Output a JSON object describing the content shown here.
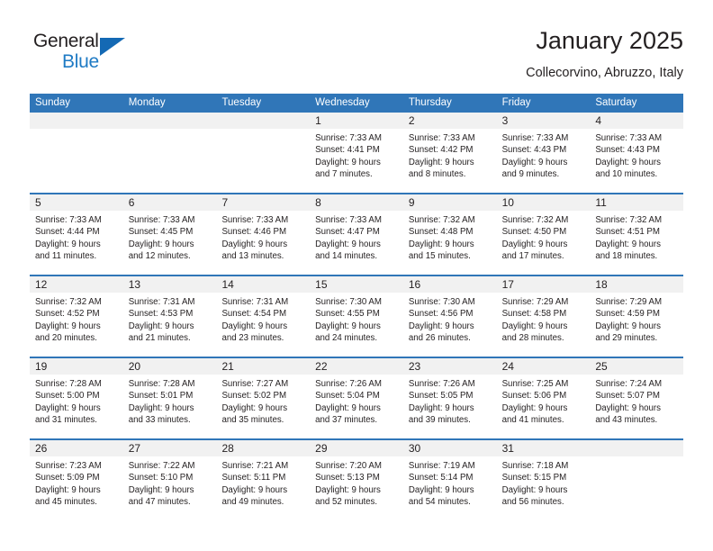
{
  "brand": {
    "name_top": "General",
    "name_bottom": "Blue",
    "accent_color": "#1469b4",
    "blue_text_color": "#1e7ac4"
  },
  "header": {
    "title": "January 2025",
    "subtitle": "Collecorvino, Abruzzo, Italy"
  },
  "calendar": {
    "header_bg": "#3076b8",
    "day_band_bg": "#f1f1f1",
    "weekday_headers": [
      "Sunday",
      "Monday",
      "Tuesday",
      "Wednesday",
      "Thursday",
      "Friday",
      "Saturday"
    ],
    "weeks": [
      [
        {
          "day": "",
          "lines": []
        },
        {
          "day": "",
          "lines": []
        },
        {
          "day": "",
          "lines": []
        },
        {
          "day": "1",
          "lines": [
            "Sunrise: 7:33 AM",
            "Sunset: 4:41 PM",
            "Daylight: 9 hours",
            "and 7 minutes."
          ]
        },
        {
          "day": "2",
          "lines": [
            "Sunrise: 7:33 AM",
            "Sunset: 4:42 PM",
            "Daylight: 9 hours",
            "and 8 minutes."
          ]
        },
        {
          "day": "3",
          "lines": [
            "Sunrise: 7:33 AM",
            "Sunset: 4:43 PM",
            "Daylight: 9 hours",
            "and 9 minutes."
          ]
        },
        {
          "day": "4",
          "lines": [
            "Sunrise: 7:33 AM",
            "Sunset: 4:43 PM",
            "Daylight: 9 hours",
            "and 10 minutes."
          ]
        }
      ],
      [
        {
          "day": "5",
          "lines": [
            "Sunrise: 7:33 AM",
            "Sunset: 4:44 PM",
            "Daylight: 9 hours",
            "and 11 minutes."
          ]
        },
        {
          "day": "6",
          "lines": [
            "Sunrise: 7:33 AM",
            "Sunset: 4:45 PM",
            "Daylight: 9 hours",
            "and 12 minutes."
          ]
        },
        {
          "day": "7",
          "lines": [
            "Sunrise: 7:33 AM",
            "Sunset: 4:46 PM",
            "Daylight: 9 hours",
            "and 13 minutes."
          ]
        },
        {
          "day": "8",
          "lines": [
            "Sunrise: 7:33 AM",
            "Sunset: 4:47 PM",
            "Daylight: 9 hours",
            "and 14 minutes."
          ]
        },
        {
          "day": "9",
          "lines": [
            "Sunrise: 7:32 AM",
            "Sunset: 4:48 PM",
            "Daylight: 9 hours",
            "and 15 minutes."
          ]
        },
        {
          "day": "10",
          "lines": [
            "Sunrise: 7:32 AM",
            "Sunset: 4:50 PM",
            "Daylight: 9 hours",
            "and 17 minutes."
          ]
        },
        {
          "day": "11",
          "lines": [
            "Sunrise: 7:32 AM",
            "Sunset: 4:51 PM",
            "Daylight: 9 hours",
            "and 18 minutes."
          ]
        }
      ],
      [
        {
          "day": "12",
          "lines": [
            "Sunrise: 7:32 AM",
            "Sunset: 4:52 PM",
            "Daylight: 9 hours",
            "and 20 minutes."
          ]
        },
        {
          "day": "13",
          "lines": [
            "Sunrise: 7:31 AM",
            "Sunset: 4:53 PM",
            "Daylight: 9 hours",
            "and 21 minutes."
          ]
        },
        {
          "day": "14",
          "lines": [
            "Sunrise: 7:31 AM",
            "Sunset: 4:54 PM",
            "Daylight: 9 hours",
            "and 23 minutes."
          ]
        },
        {
          "day": "15",
          "lines": [
            "Sunrise: 7:30 AM",
            "Sunset: 4:55 PM",
            "Daylight: 9 hours",
            "and 24 minutes."
          ]
        },
        {
          "day": "16",
          "lines": [
            "Sunrise: 7:30 AM",
            "Sunset: 4:56 PM",
            "Daylight: 9 hours",
            "and 26 minutes."
          ]
        },
        {
          "day": "17",
          "lines": [
            "Sunrise: 7:29 AM",
            "Sunset: 4:58 PM",
            "Daylight: 9 hours",
            "and 28 minutes."
          ]
        },
        {
          "day": "18",
          "lines": [
            "Sunrise: 7:29 AM",
            "Sunset: 4:59 PM",
            "Daylight: 9 hours",
            "and 29 minutes."
          ]
        }
      ],
      [
        {
          "day": "19",
          "lines": [
            "Sunrise: 7:28 AM",
            "Sunset: 5:00 PM",
            "Daylight: 9 hours",
            "and 31 minutes."
          ]
        },
        {
          "day": "20",
          "lines": [
            "Sunrise: 7:28 AM",
            "Sunset: 5:01 PM",
            "Daylight: 9 hours",
            "and 33 minutes."
          ]
        },
        {
          "day": "21",
          "lines": [
            "Sunrise: 7:27 AM",
            "Sunset: 5:02 PM",
            "Daylight: 9 hours",
            "and 35 minutes."
          ]
        },
        {
          "day": "22",
          "lines": [
            "Sunrise: 7:26 AM",
            "Sunset: 5:04 PM",
            "Daylight: 9 hours",
            "and 37 minutes."
          ]
        },
        {
          "day": "23",
          "lines": [
            "Sunrise: 7:26 AM",
            "Sunset: 5:05 PM",
            "Daylight: 9 hours",
            "and 39 minutes."
          ]
        },
        {
          "day": "24",
          "lines": [
            "Sunrise: 7:25 AM",
            "Sunset: 5:06 PM",
            "Daylight: 9 hours",
            "and 41 minutes."
          ]
        },
        {
          "day": "25",
          "lines": [
            "Sunrise: 7:24 AM",
            "Sunset: 5:07 PM",
            "Daylight: 9 hours",
            "and 43 minutes."
          ]
        }
      ],
      [
        {
          "day": "26",
          "lines": [
            "Sunrise: 7:23 AM",
            "Sunset: 5:09 PM",
            "Daylight: 9 hours",
            "and 45 minutes."
          ]
        },
        {
          "day": "27",
          "lines": [
            "Sunrise: 7:22 AM",
            "Sunset: 5:10 PM",
            "Daylight: 9 hours",
            "and 47 minutes."
          ]
        },
        {
          "day": "28",
          "lines": [
            "Sunrise: 7:21 AM",
            "Sunset: 5:11 PM",
            "Daylight: 9 hours",
            "and 49 minutes."
          ]
        },
        {
          "day": "29",
          "lines": [
            "Sunrise: 7:20 AM",
            "Sunset: 5:13 PM",
            "Daylight: 9 hours",
            "and 52 minutes."
          ]
        },
        {
          "day": "30",
          "lines": [
            "Sunrise: 7:19 AM",
            "Sunset: 5:14 PM",
            "Daylight: 9 hours",
            "and 54 minutes."
          ]
        },
        {
          "day": "31",
          "lines": [
            "Sunrise: 7:18 AM",
            "Sunset: 5:15 PM",
            "Daylight: 9 hours",
            "and 56 minutes."
          ]
        },
        {
          "day": "",
          "lines": []
        }
      ]
    ]
  }
}
